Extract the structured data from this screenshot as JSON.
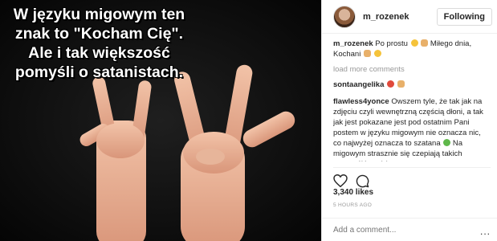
{
  "post": {
    "caption_text": "W języku migowym ten znak to \"Kocham Cię\". Ale i tak większość pomyśli o satanistach."
  },
  "header": {
    "username": "m_rozenek",
    "follow_label": "Following"
  },
  "comments": [
    {
      "user": "m_rozenek",
      "text": "Po prostu",
      "text2": "Miłego dnia, Kochani"
    },
    {
      "user": "sontaangelika",
      "text": ""
    },
    {
      "user": "flawless4yonce",
      "text": "Owszem tyle, że tak jak na zdjęciu czyli wewnętrzną częścią dłoni, a tak jak jest pokazane jest pod ostatnim Pani postem w języku migowym nie oznacza nic, co najwyżej oznacza to szatana",
      "text2": "Na migowym strasznie się czepiają takich szczegółów także następnym razem"
    }
  ],
  "load_more": "load more comments",
  "likes": "3,340 likes",
  "timestamp": "5 HOURS AGO",
  "add_comment": {
    "placeholder": "Add a comment..."
  },
  "more_icon": "..."
}
